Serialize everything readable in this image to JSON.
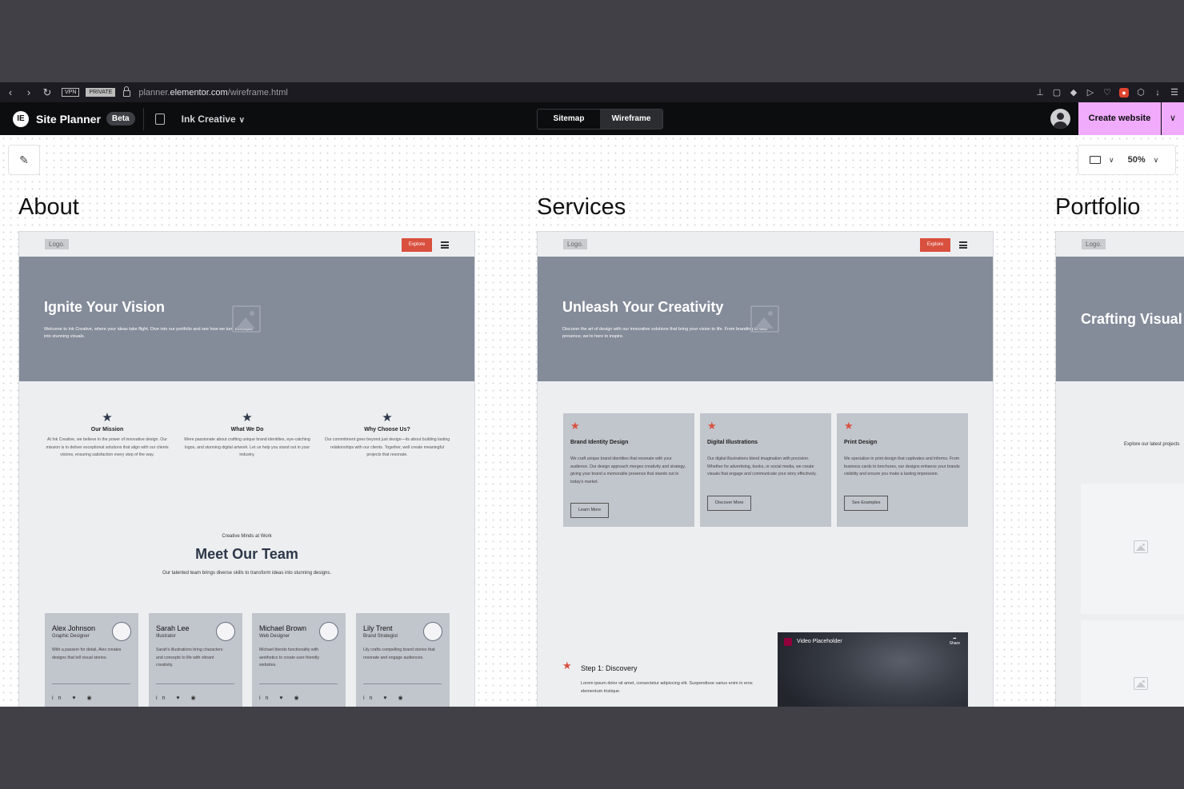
{
  "browser": {
    "vpn_label": "VPN",
    "private_label": "PRIVATE",
    "url_prefix": "planner.",
    "url_domain": "elementor.com",
    "url_path": "/wireframe.html"
  },
  "header": {
    "logo_text": "IE",
    "app_title": "Site Planner",
    "badge": "Beta",
    "project_name": "Ink Creative",
    "tabs": [
      {
        "label": "Sitemap",
        "active": false
      },
      {
        "label": "Wireframe",
        "active": true
      }
    ],
    "create_button": "Create website"
  },
  "toolbar": {
    "zoom": "50%"
  },
  "about": {
    "page_title": "About",
    "logo": "Logo.",
    "explore": "Explore",
    "hero_title": "Ignite Your Vision",
    "hero_sub": "Welcome to Ink Creative, where your ideas take flight. Dive into our portfolio and see how we turn concepts into stunning visuals.",
    "features": [
      {
        "title": "Our Mission",
        "desc": "At Ink Creative, we believe in the power of innovative design. Our mission is to deliver exceptional solutions that align with our clients visions, ensuring satisfaction every step of the way."
      },
      {
        "title": "What We Do",
        "desc": "Were passionate about crafting unique brand identities, eye-catching logos, and stunning digital artwork. Let us help you stand out in your industry."
      },
      {
        "title": "Why Choose Us?",
        "desc": "Our commitment goes beyond just design—its about building lasting relationships with our clients. Together, well create meaningful projects that resonate."
      }
    ],
    "team_kicker": "Creative Minds at Work",
    "team_title": "Meet Our Team",
    "team_sub": "Our talented team brings diverse skills to transform ideas into stunning designs.",
    "members": [
      {
        "name": "Alex Johnson",
        "role": "Graphic Designer",
        "desc": "With a passion for detail, Alex creates designs that tell visual stories."
      },
      {
        "name": "Sarah Lee",
        "role": "Illustrator",
        "desc": "Sarah's illustrations bring characters and concepts to life with vibrant creativity."
      },
      {
        "name": "Michael Brown",
        "role": "Web Designer",
        "desc": "Michael blends functionality with aesthetics to create user-friendly websites."
      },
      {
        "name": "Lily Trent",
        "role": "Brand Strategist",
        "desc": "Lily crafts compelling brand stories that resonate and engage audiences."
      }
    ],
    "social_icons": "in ♥ ◉"
  },
  "services": {
    "page_title": "Services",
    "logo": "Logo.",
    "explore": "Explore",
    "hero_title": "Unleash Your Creativity",
    "hero_sub": "Discover the art of design with our innovative solutions that bring your vision to life. From branding to web presence, we're here to inspire.",
    "cards": [
      {
        "title": "Brand Identity Design",
        "desc": "We craft unique brand identities that resonate with your audience. Our design approach merges creativity and strategy, giving your brand a memorable presence that stands out in today's market.",
        "button": "Learn More"
      },
      {
        "title": "Digital Illustrations",
        "desc": "Our digital illustrations blend imagination with precision. Whether for advertising, books, or social media, we create visuals that engage and communicate your story effectively.",
        "button": "Discover More"
      },
      {
        "title": "Print Design",
        "desc": "We specialize in print design that captivates and informs. From business cards to brochures, our designs enhance your brands visibility and ensure you make a lasting impression.",
        "button": "See Examples"
      }
    ],
    "step_title": "Step 1: Discovery",
    "step_desc": "Lorem ipsum dolor sit amet, consectetur adipiscing elit. Suspendisse varius enim in eros elementum tristique.",
    "video_title": "Video Placeholder",
    "video_share": "Share"
  },
  "portfolio": {
    "page_title": "Portfolio",
    "logo": "Logo.",
    "hero_title": "Crafting Visual",
    "sub": "Explore our latest projects"
  }
}
